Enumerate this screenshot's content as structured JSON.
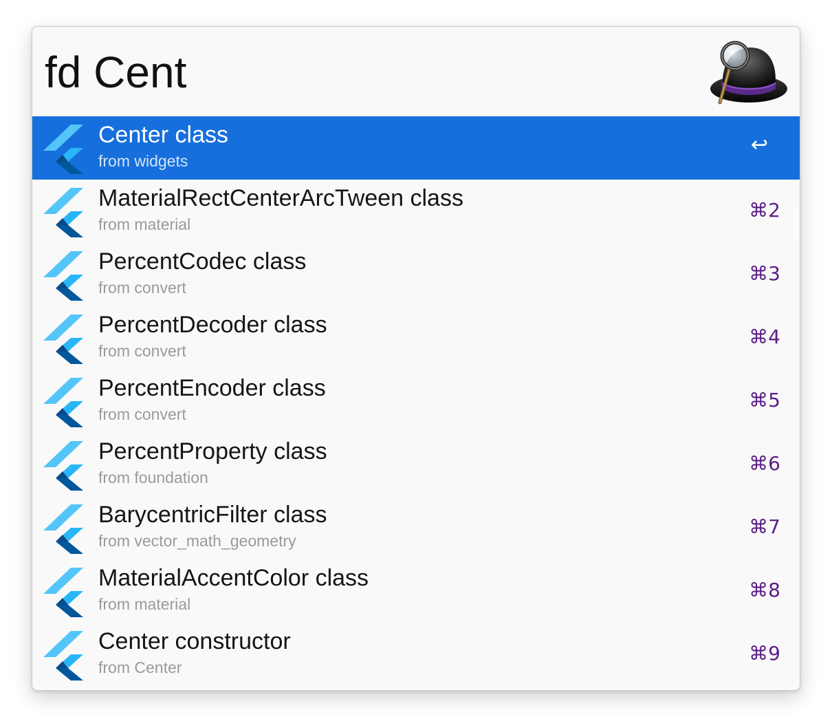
{
  "search": {
    "query": "fd Cent"
  },
  "app": {
    "logo_icon": "alfred-hat-icon"
  },
  "colors": {
    "selection": "#166fdc",
    "shortcut": "#5a1d86",
    "flutter_light": "#54c5f8",
    "flutter_mid": "#29b6f6",
    "flutter_dark": "#01579b"
  },
  "results": [
    {
      "title": "Center class",
      "subtitle": "from widgets",
      "shortcut": "↩",
      "selected": true,
      "icon": "flutter-icon"
    },
    {
      "title": "MaterialRectCenterArcTween class",
      "subtitle": "from material",
      "shortcut": "⌘2",
      "icon": "flutter-icon"
    },
    {
      "title": "PercentCodec class",
      "subtitle": "from convert",
      "shortcut": "⌘3",
      "icon": "flutter-icon"
    },
    {
      "title": "PercentDecoder class",
      "subtitle": "from convert",
      "shortcut": "⌘4",
      "icon": "flutter-icon"
    },
    {
      "title": "PercentEncoder class",
      "subtitle": "from convert",
      "shortcut": "⌘5",
      "icon": "flutter-icon"
    },
    {
      "title": "PercentProperty class",
      "subtitle": "from foundation",
      "shortcut": "⌘6",
      "icon": "flutter-icon"
    },
    {
      "title": "BarycentricFilter class",
      "subtitle": "from vector_math_geometry",
      "shortcut": "⌘7",
      "icon": "flutter-icon"
    },
    {
      "title": "MaterialAccentColor class",
      "subtitle": "from material",
      "shortcut": "⌘8",
      "icon": "flutter-icon"
    },
    {
      "title": "Center constructor",
      "subtitle": "from Center",
      "shortcut": "⌘9",
      "icon": "flutter-icon"
    }
  ]
}
